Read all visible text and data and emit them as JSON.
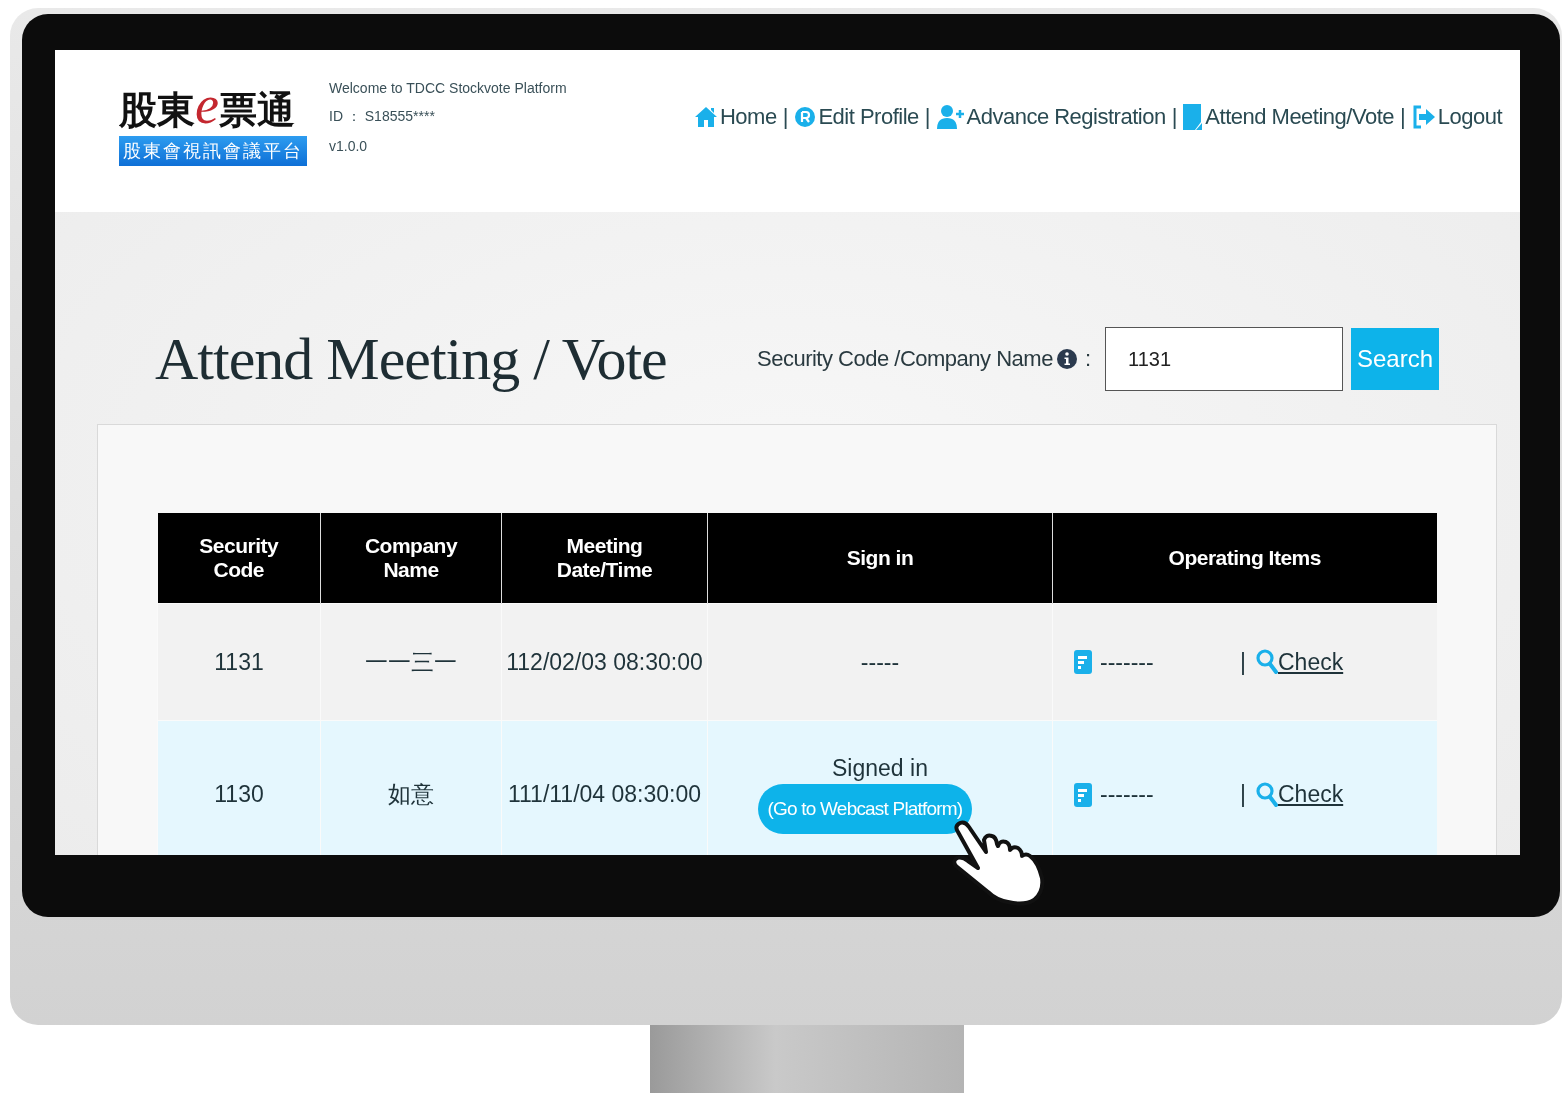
{
  "header": {
    "logo": {
      "title_parts": [
        "股東",
        "e",
        "票通"
      ],
      "subtitle": "股東會視訊會議平台"
    },
    "welcome": "Welcome to TDCC Stockvote Platform",
    "user_id": "ID ： S18555****",
    "version": "v1.0.0",
    "nav": [
      {
        "kind": "home",
        "label": "Home",
        "separator": "|"
      },
      {
        "kind": "profile",
        "label": "Edit Profile",
        "separator": "|"
      },
      {
        "kind": "registration",
        "label": "Advance Registration",
        "separator": "|"
      },
      {
        "kind": "meeting",
        "label": "Attend Meeting/Vote",
        "separator": "|"
      },
      {
        "kind": "logout",
        "label": "Logout"
      }
    ]
  },
  "page": {
    "title": "Attend Meeting / Vote",
    "search": {
      "label": "Security Code /Company Name",
      "colon": ":",
      "value": "1131",
      "button": "Search"
    }
  },
  "table": {
    "columns": [
      "Security Code",
      "Company Name",
      "Meeting Date/Time",
      "Sign in",
      "Operating Items"
    ],
    "rows": [
      {
        "selected": false,
        "security_code": "1131",
        "company_name": "一一三一",
        "meeting_datetime": "112/02/03 08:30:00",
        "sign_in": {
          "kind": "none",
          "text": "-----"
        },
        "operating": {
          "status": "-------",
          "separator": "|",
          "link": "Check"
        }
      },
      {
        "selected": true,
        "security_code": "1130",
        "company_name": "如意",
        "meeting_datetime": "111/11/04 08:30:00",
        "sign_in": {
          "kind": "signed",
          "text": "Signed in",
          "button": "(Go to Webcast Platform)"
        },
        "operating": {
          "status": "-------",
          "separator": "|",
          "link": "Check"
        }
      }
    ]
  }
}
